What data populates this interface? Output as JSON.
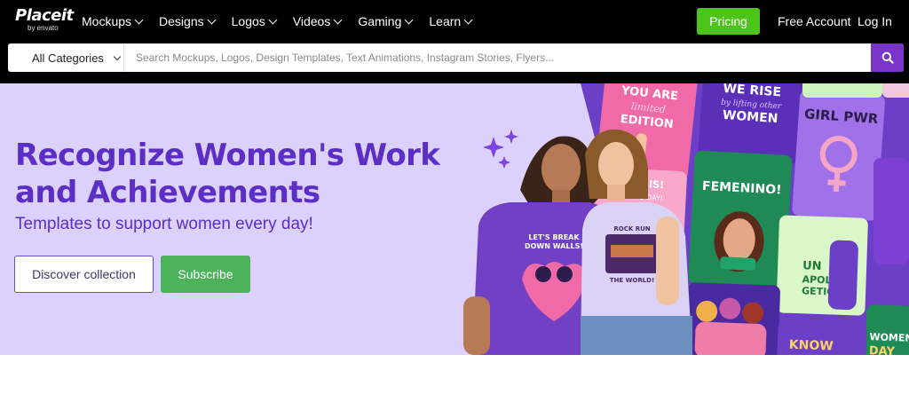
{
  "brand": {
    "logo_text": "Placeit",
    "logo_sub": "by envato"
  },
  "nav": {
    "items": [
      "Mockups",
      "Designs",
      "Logos",
      "Videos",
      "Gaming",
      "Learn"
    ],
    "pricing": "Pricing",
    "free_account": "Free Account",
    "login": "Log In"
  },
  "search": {
    "category": "All Categories",
    "placeholder": "Search Mockups, Logos, Design Templates, Text Animations, Instagram Stories, Flyers..."
  },
  "hero": {
    "title": "Recognize Women's Work and Achievements",
    "subtitle": "Templates to support women every day!",
    "discover_label": "Discover collection",
    "subscribe_label": "Subscribe",
    "shirt_left_text": "LET'S BREAK DOWN WALLS!",
    "shirt_right_text": "ROCK RUN THE WORLD!",
    "cards": [
      "YOU ARE limited EDITION",
      "WE RISE by lifting other WOMEN",
      "GIRL PWR",
      "HERE SIS! WOMEN'S DAY!",
      "FEMENINO!",
      "UN APOLO GETIC.",
      "KNOW",
      "WOMEN'S DAY"
    ]
  },
  "colors": {
    "hero_bg": "#dcd0fc",
    "accent_purple": "#5b2fc6",
    "pricing_green": "#4cc41a",
    "subscribe_green": "#4cb35a",
    "search_button": "#7a35c8"
  },
  "icons": [
    "sparkle-icon",
    "search-icon",
    "chevron-down-icon"
  ]
}
